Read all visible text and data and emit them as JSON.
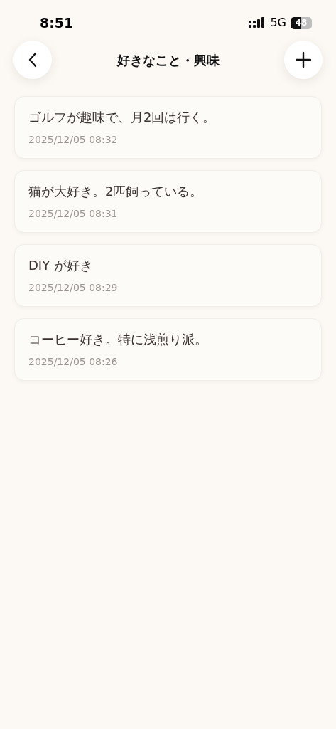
{
  "status_bar": {
    "time": "8:51",
    "network": "5G",
    "battery": "48"
  },
  "header": {
    "title": "好きなこと・興味"
  },
  "entries": [
    {
      "text": "ゴルフが趣味で、月2回は行く。",
      "date": "2025/12/05 08:32"
    },
    {
      "text": "猫が大好き。2匹飼っている。",
      "date": "2025/12/05 08:31"
    },
    {
      "text": "DIY が好き",
      "date": "2025/12/05 08:29"
    },
    {
      "text": "コーヒー好き。特に浅煎り派。",
      "date": "2025/12/05 08:26"
    }
  ]
}
